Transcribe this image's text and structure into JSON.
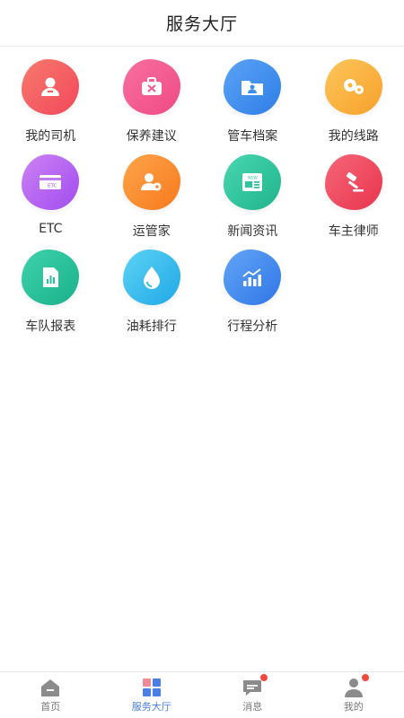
{
  "header": {
    "title": "服务大厅"
  },
  "services": [
    {
      "label": "我的司机",
      "icon": "driver-icon",
      "color": "#f55a5f"
    },
    {
      "label": "保养建议",
      "icon": "toolbox-icon",
      "color": "#f2578f"
    },
    {
      "label": "管车档案",
      "icon": "folder-icon",
      "color": "#3b8ff0"
    },
    {
      "label": "我的线路",
      "icon": "route-icon",
      "color": "#fbb13c"
    },
    {
      "label": "ETC",
      "icon": "etc-card-icon",
      "color": "#b35ef0"
    },
    {
      "label": "运管家",
      "icon": "manager-icon",
      "color": "#fb8a2e"
    },
    {
      "label": "新闻资讯",
      "icon": "news-icon",
      "color": "#2ec6a0"
    },
    {
      "label": "车主律师",
      "icon": "gavel-icon",
      "color": "#f0475f"
    },
    {
      "label": "车队报表",
      "icon": "report-icon",
      "color": "#26c39b"
    },
    {
      "label": "油耗排行",
      "icon": "fuel-drop-icon",
      "color": "#33c0ee"
    },
    {
      "label": "行程分析",
      "icon": "chart-icon",
      "color": "#3f8cf2"
    }
  ],
  "tabbar": {
    "items": [
      {
        "label": "首页",
        "icon": "home-icon",
        "active": false,
        "badge": false
      },
      {
        "label": "服务大厅",
        "icon": "grid-icon",
        "active": true,
        "badge": false
      },
      {
        "label": "消息",
        "icon": "message-icon",
        "active": false,
        "badge": true
      },
      {
        "label": "我的",
        "icon": "profile-icon",
        "active": false,
        "badge": true
      }
    ]
  }
}
